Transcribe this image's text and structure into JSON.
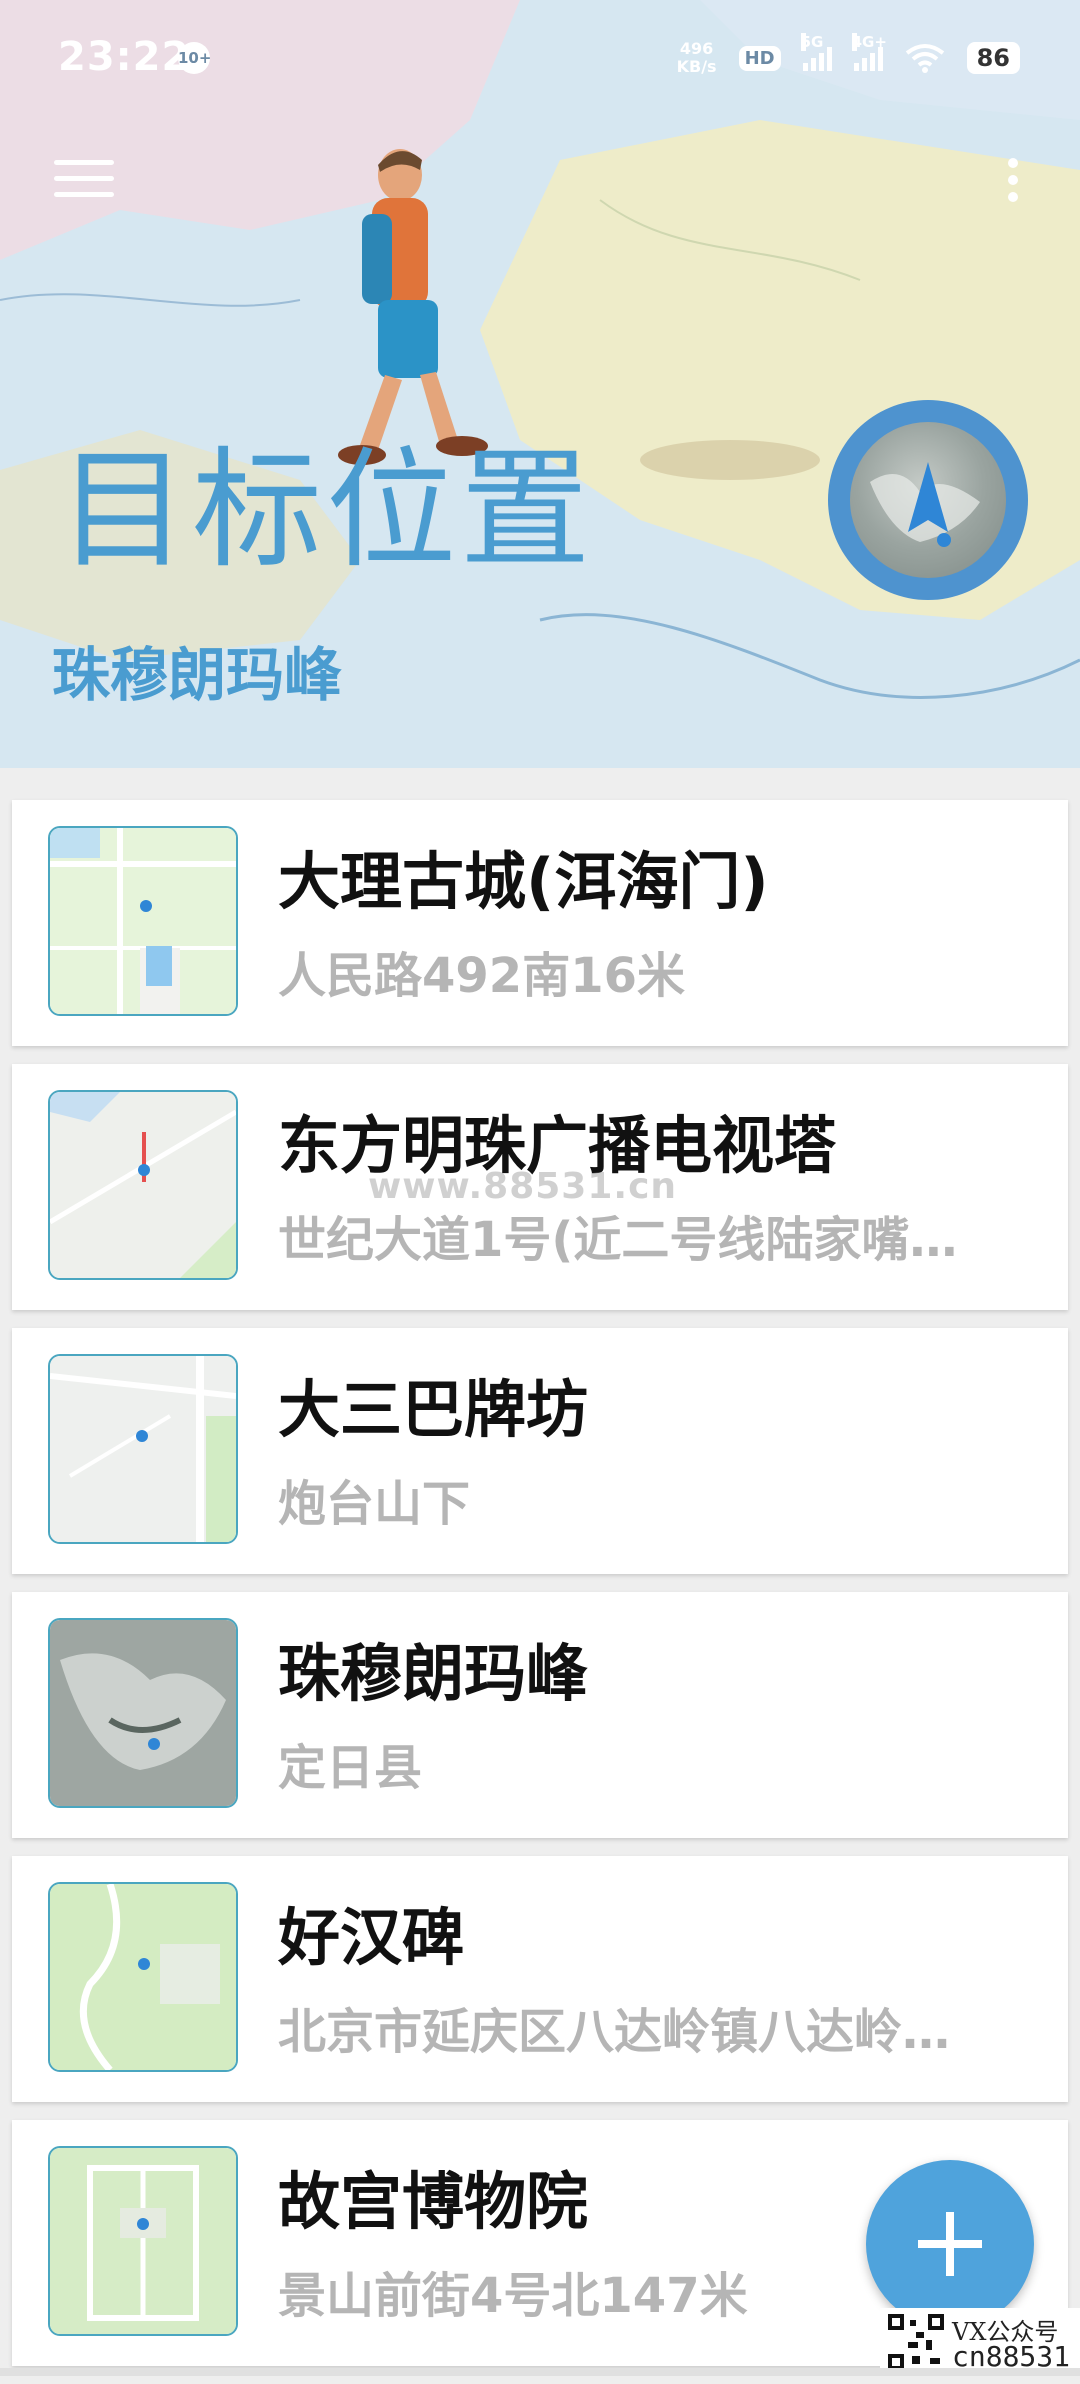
{
  "status": {
    "time": "23:22",
    "notif_badge": "10+",
    "net_speed_top": "496",
    "net_speed_bottom": "KB/s",
    "hd_label": "HD",
    "sig1_label": "5G",
    "sig2_label": "4G+",
    "battery": "86"
  },
  "header": {
    "title": "目标位置",
    "subtitle": "珠穆朗玛峰",
    "accent": "#4a9cd0"
  },
  "locations": [
    {
      "title": "大理古城(洱海门)",
      "subtitle": "人民路492南16米",
      "map_type": "street"
    },
    {
      "title": "东方明珠广播电视塔",
      "subtitle": "世纪大道1号(近二号线陆家嘴…",
      "map_type": "street"
    },
    {
      "title": "大三巴牌坊",
      "subtitle": "炮台山下",
      "map_type": "street"
    },
    {
      "title": "珠穆朗玛峰",
      "subtitle": "定日县",
      "map_type": "satellite"
    },
    {
      "title": "好汉碑",
      "subtitle": "北京市延庆区八达岭镇八达岭…",
      "map_type": "street"
    },
    {
      "title": "故宫博物院",
      "subtitle": "景山前街4号北147米",
      "map_type": "street"
    }
  ],
  "fab": {
    "icon": "plus-icon",
    "color": "#4fa3dc"
  },
  "watermark": "www.88531.cn",
  "qr_caption": {
    "line1": "VX公众号",
    "line2": "cn88531"
  }
}
